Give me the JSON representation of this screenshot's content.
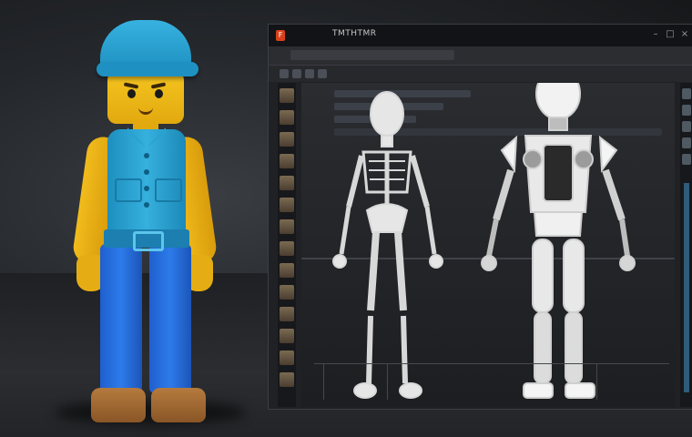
{
  "scene": {
    "character": {
      "name": "blocky-worker-figure"
    },
    "editor_window": {
      "title": "TMTHTMR",
      "app_icon_glyph": "F",
      "window_controls": [
        "–",
        "□",
        "×"
      ],
      "icons": [
        "app-icon",
        "minimize-icon",
        "maximize-icon",
        "close-icon"
      ]
    },
    "colors": {
      "cap": "#2fa7d8",
      "vest": "#33abd9",
      "skin": "#f0b81b",
      "pants": "#2a73e0",
      "shoes": "#9b6430",
      "editor_bg": "#1f2125"
    }
  }
}
